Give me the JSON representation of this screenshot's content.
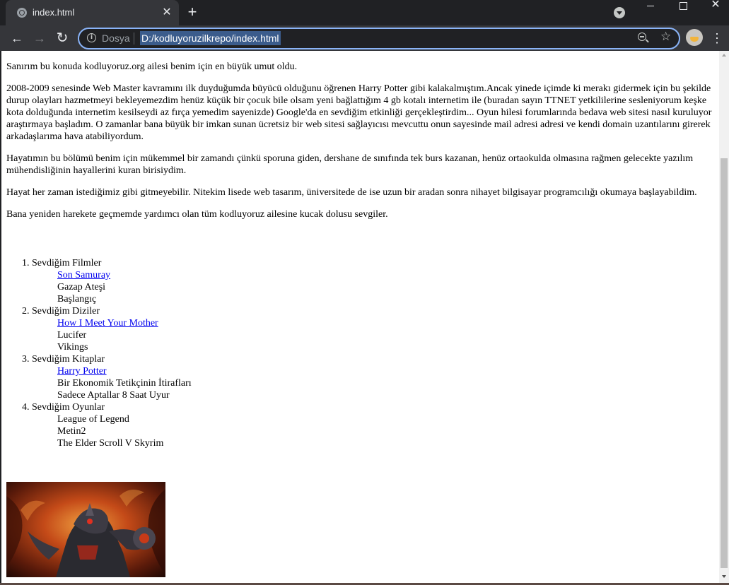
{
  "window": {
    "tab_title": "index.html",
    "tab_close": "✕",
    "new_tab": "+",
    "minimize_label": "",
    "maximize_label": "",
    "close_label": "✕"
  },
  "toolbar": {
    "back_icon": "←",
    "forward_icon": "→",
    "reload_icon": "↻",
    "info_icon": "i",
    "scheme_label": "Dosya",
    "url": "D:/kodluyoruzilkrepo/index.html",
    "bookmark_icon": "☆",
    "menu_icon": "⋮"
  },
  "page": {
    "paragraphs": [
      "Sanırım bu konuda kodluyoruz.org ailesi benim için en büyük umut oldu.",
      "2008-2009 senesinde Web Master kavramını ilk duyduğumda büyücü olduğunu öğrenen Harry Potter gibi kalakalmıştım.Ancak yinede içimde ki merakı gidermek için bu şekilde durup olayları hazmetmeyi bekleyemezdim henüz küçük bir çocuk bile olsam yeni bağlattığım 4 gb kotalı internetim ile (buradan sayın TTNET yetkililerine sesleniyorum keşke kota dolduğunda internetim kesilseydi az fırça yemedim sayenizde) Google'da en sevdiğim etkinliği gerçekleştirdim... Oyun hilesi forumlarında bedava web sitesi nasıl kuruluyor araştırmaya başladım. O zamanlar bana büyük bir imkan sunan ücretsiz bir web sitesi sağlayıcısı mevcuttu onun sayesinde mail adresi adresi ve kendi domain uzantılarını girerek arkadaşlarıma hava atabiliyordum.",
      "Hayatımın bu bölümü benim için mükemmel bir zamandı çünkü sporuna giden, dershane de sınıfında tek burs kazanan, henüz ortaokulda olmasına rağmen gelecekte yazılım mühendisliğinin hayallerini kuran birisiydim.",
      "Hayat her zaman istediğimiz gibi gitmeyebilir. Nitekim lisede web tasarım, üniversitede de ise uzun bir aradan sonra nihayet bilgisayar programcılığı okumaya başlayabildim.",
      "Bana yeniden harekete geçmemde yardımcı olan tüm kodluyoruz ailesine kucak dolusu sevgiler."
    ],
    "lists": [
      {
        "title": "Sevdiğim Filmler",
        "link": "Son Samuray",
        "items": [
          "Gazap Ateşi",
          "Başlangıç"
        ]
      },
      {
        "title": "Sevdiğim Diziler",
        "link": "How I Meet Your Mother",
        "items": [
          "Lucifer",
          "Vikings"
        ]
      },
      {
        "title": "Sevdiğim Kitaplar",
        "link": "Harry Potter",
        "items": [
          "Bir Ekonomik Tetikçinin İtirafları",
          "Sadece Aptallar 8 Saat Uyur"
        ]
      },
      {
        "title": "Sevdiğim Oyunlar",
        "link": "",
        "items": [
          "League of Legend",
          "Metin2",
          "The Elder Scroll V Skyrim"
        ]
      }
    ]
  },
  "colors": {
    "omnibox_focus": "#8ab4f8",
    "link": "#0000ee",
    "url_selection": "#3b5c8c"
  }
}
